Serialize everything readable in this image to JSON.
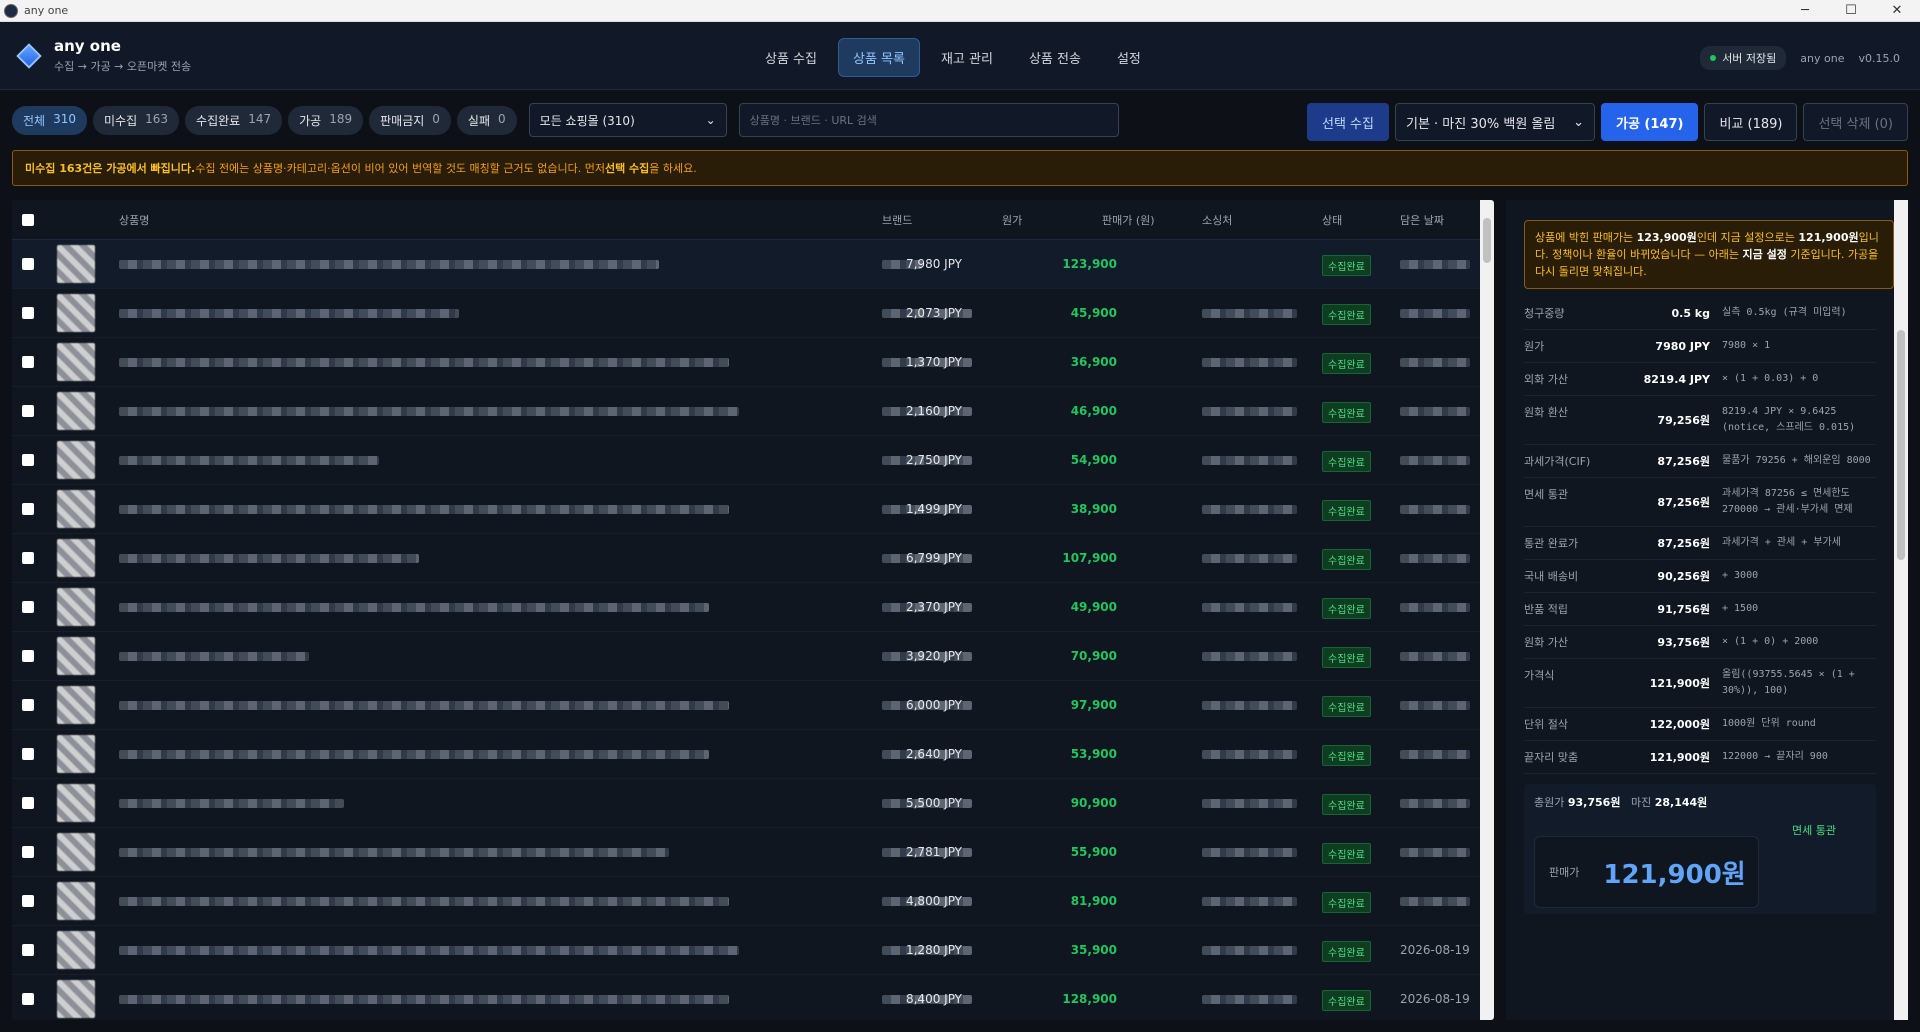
{
  "window": {
    "title": "any one",
    "controls": [
      "─",
      "☐",
      "✕"
    ]
  },
  "brand": {
    "title": "any one",
    "subtitle": "수집 → 가공 → 오픈마켓 전송"
  },
  "nav": {
    "tabs": [
      "상품 수집",
      "상품 목록",
      "재고 관리",
      "상품 전송",
      "설정"
    ]
  },
  "header_right": {
    "saved": "서버 저장됨",
    "user": "any one",
    "version": "v0.15.0"
  },
  "filters": [
    {
      "label": "전체",
      "count": "310"
    },
    {
      "label": "미수집",
      "count": "163"
    },
    {
      "label": "수집완료",
      "count": "147"
    },
    {
      "label": "가공",
      "count": "189"
    },
    {
      "label": "판매금지",
      "count": "0"
    },
    {
      "label": "실패",
      "count": "0"
    }
  ],
  "mall_select": "모든 쇼핑몰 (310)",
  "search_placeholder": "상품명 · 브랜드 · URL 검색",
  "actions": {
    "collect": "선택 수집",
    "preset": "기본 · 마진 30% 백원 올림",
    "process": "가공 (147)",
    "compare": "비교 (189)",
    "delete": "선택 삭제 (0)"
  },
  "alert": {
    "bold1": "미수집 163건은 가공에서 빠집니다.",
    "text1": " 수집 전에는 상품명·카테고리·옵션이 비어 있어 번역할 것도 매칭할 근거도 없습니다. 먼저 ",
    "bold2": "선택 수집",
    "text2": "을 하세요."
  },
  "table": {
    "headers": {
      "name": "상품명",
      "brand": "브랜드",
      "cost": "원가",
      "sale": "판매가 (원)",
      "source": "소싱처",
      "status": "상태",
      "date": "담은 날짜"
    },
    "rows": [
      {
        "cost": "7,980 JPY",
        "sale": "123,900",
        "status": "수집완료",
        "date": ""
      },
      {
        "cost": "2,073 JPY",
        "sale": "45,900",
        "status": "수집완료",
        "date": ""
      },
      {
        "cost": "1,370 JPY",
        "sale": "36,900",
        "status": "수집완료",
        "date": ""
      },
      {
        "cost": "2,160 JPY",
        "sale": "46,900",
        "status": "수집완료",
        "date": ""
      },
      {
        "cost": "2,750 JPY",
        "sale": "54,900",
        "status": "수집완료",
        "date": ""
      },
      {
        "cost": "1,499 JPY",
        "sale": "38,900",
        "status": "수집완료",
        "date": ""
      },
      {
        "cost": "6,799 JPY",
        "sale": "107,900",
        "status": "수집완료",
        "date": ""
      },
      {
        "cost": "2,370 JPY",
        "sale": "49,900",
        "status": "수집완료",
        "date": ""
      },
      {
        "cost": "3,920 JPY",
        "sale": "70,900",
        "status": "수집완료",
        "date": ""
      },
      {
        "cost": "6,000 JPY",
        "sale": "97,900",
        "status": "수집완료",
        "date": ""
      },
      {
        "cost": "2,640 JPY",
        "sale": "53,900",
        "status": "수집완료",
        "date": ""
      },
      {
        "cost": "5,500 JPY",
        "sale": "90,900",
        "status": "수집완료",
        "date": ""
      },
      {
        "cost": "2,781 JPY",
        "sale": "55,900",
        "status": "수집완료",
        "date": ""
      },
      {
        "cost": "4,800 JPY",
        "sale": "81,900",
        "status": "수집완료",
        "date": ""
      },
      {
        "cost": "1,280 JPY",
        "sale": "35,900",
        "status": "수집완료",
        "date": "2026-08-19"
      },
      {
        "cost": "8,400 JPY",
        "sale": "128,900",
        "status": "수집완료",
        "date": "2026-08-19"
      }
    ]
  },
  "panel": {
    "note": {
      "t1": "상품에 박힌 판매가는 ",
      "b1": "123,900원",
      "t2": "인데 지금 설정으로는 ",
      "b2": "121,900원",
      "t3": "입니다. 정책이나 환율이 바뀌었습니다 — 아래는 ",
      "b3": "지금 설정",
      "t4": " 기준입니다. 가공을 다시 돌리면 맞춰집니다."
    },
    "calc": [
      {
        "k": "청구중량",
        "v": "0.5 kg",
        "f": "실측 0.5kg (규격 미입력)"
      },
      {
        "k": "원가",
        "v": "7980 JPY",
        "f": "7980 × 1"
      },
      {
        "k": "외화 가산",
        "v": "8219.4 JPY",
        "f": "× (1 + 0.03) + 0"
      },
      {
        "k": "원화 환산",
        "v": "79,256원",
        "f": "8219.4 JPY × 9.6425 (notice, 스프레드 0.015)"
      },
      {
        "k": "과세가격(CIF)",
        "v": "87,256원",
        "f": "물품가 79256 + 해외운임 8000"
      },
      {
        "k": "면세 통관",
        "v": "87,256원",
        "f": "과세가격 87256 ≤ 면세한도 270000 → 관세·부가세 면제"
      },
      {
        "k": "통관 완료가",
        "v": "87,256원",
        "f": "과세가격 + 관세 + 부가세"
      },
      {
        "k": "국내 배송비",
        "v": "90,256원",
        "f": "+ 3000"
      },
      {
        "k": "반품 적립",
        "v": "91,756원",
        "f": "+ 1500"
      },
      {
        "k": "원화 가산",
        "v": "93,756원",
        "f": "× (1 + 0) + 2000"
      },
      {
        "k": "가격식",
        "v": "121,900원",
        "f": "올림((93755.5645 × (1 + 30%)), 100)"
      },
      {
        "k": "단위 절삭",
        "v": "122,000원",
        "f": "1000원 단위 round"
      },
      {
        "k": "끝자리 맞춤",
        "v": "121,900원",
        "f": "122000 → 끝자리 900"
      }
    ],
    "summary": {
      "cost_label": "총원가",
      "cost": "93,756원",
      "margin_label": "마진",
      "margin": "28,144원",
      "duty": "면세 통관",
      "sale_label": "판매가",
      "sale": "121,900원"
    }
  }
}
